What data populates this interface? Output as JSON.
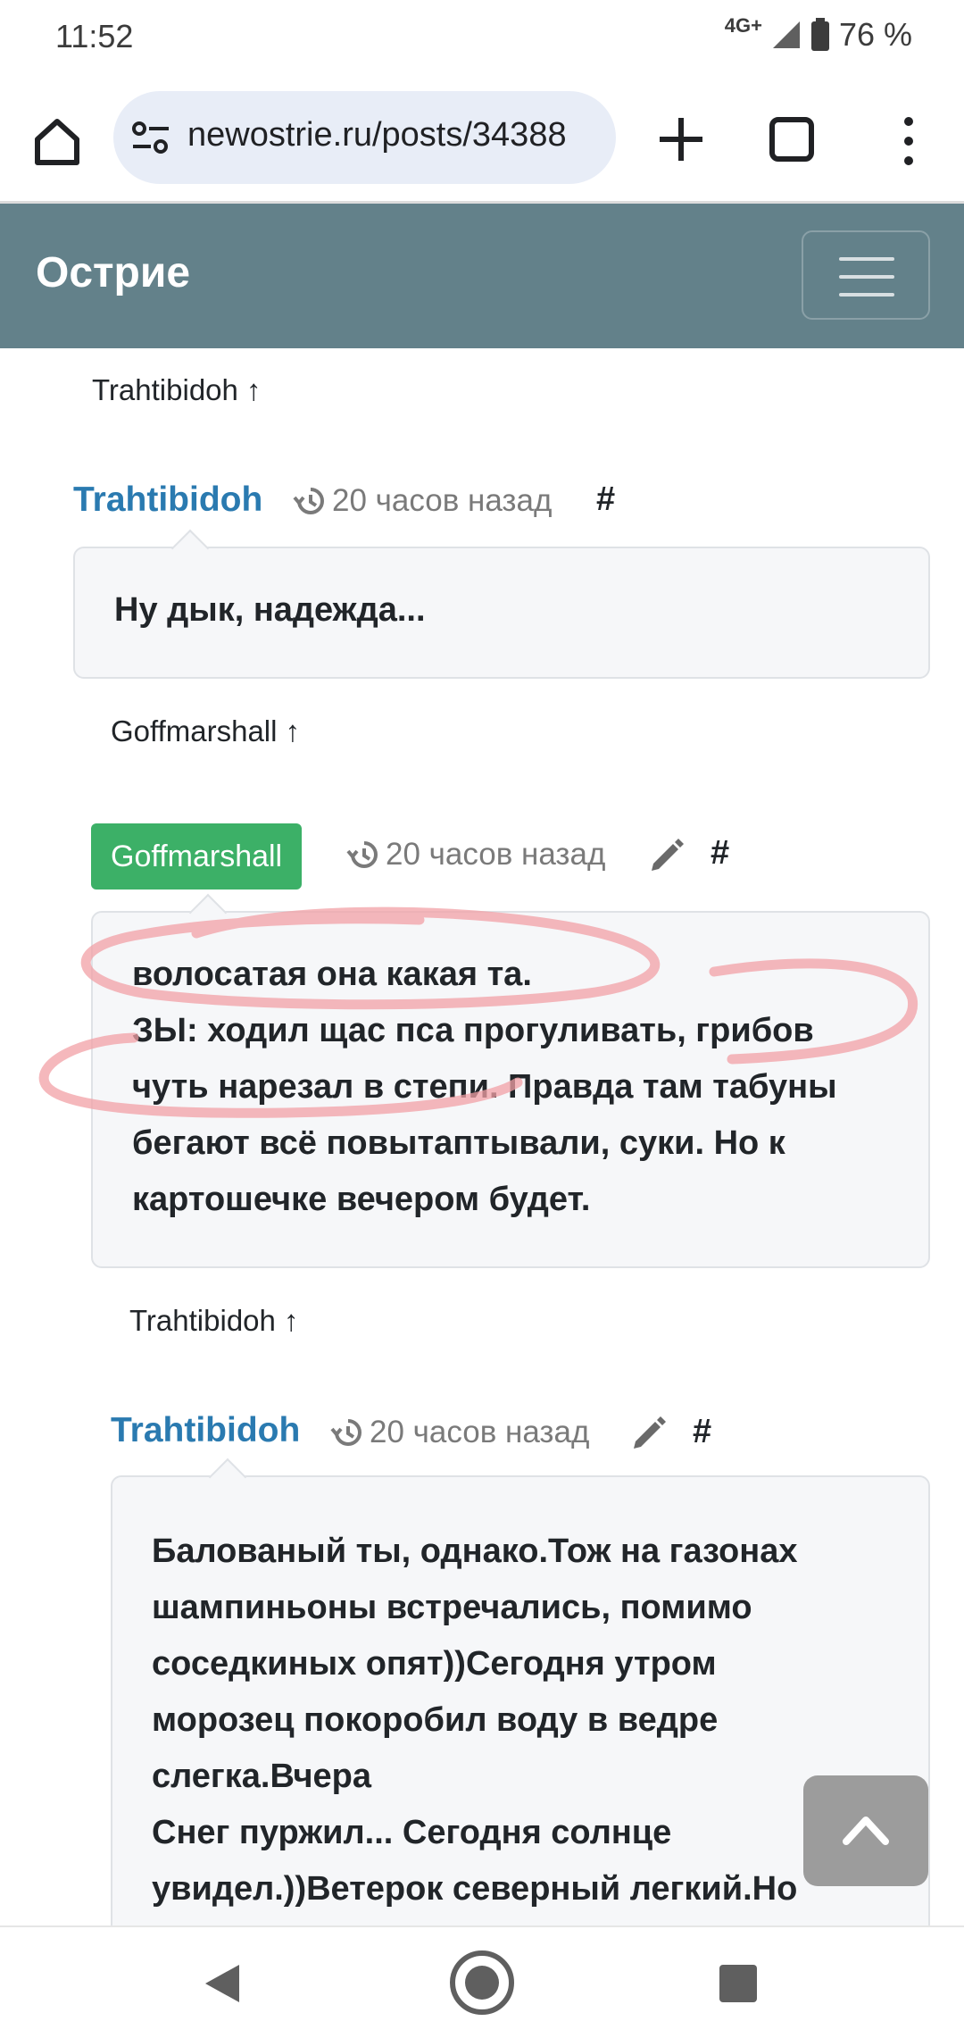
{
  "status_bar": {
    "time": "11:52",
    "network": "4G+",
    "battery": "76 %"
  },
  "browser": {
    "url": "newostrie.ru/posts/34388"
  },
  "navbar": {
    "brand": "Острие"
  },
  "comments": [
    {
      "reply_to": "Trahtibidoh ↑"
    },
    {
      "author": "Trahtibidoh",
      "time": "20 часов назад",
      "hash": "#",
      "text": "Ну дык, надежда..."
    },
    {
      "reply_to": "Goffmarshall ↑"
    },
    {
      "author": "Goffmarshall",
      "time": "20 часов назад",
      "hash": "#",
      "text": "волосатая она какая та.\nЗЫ: ходил щас пса прогуливать, грибов\nчуть нарезал в степи. Правда там табуны\nбегают всё повытаптывали, суки. Но к\nкартошечке вечером будет."
    },
    {
      "reply_to": "Trahtibidoh ↑"
    },
    {
      "author": "Trahtibidoh",
      "time": "20 часов назад",
      "hash": "#",
      "text": "Балованый ты, однако.Тож на газонах\nшампиньоны встречались, помимо\nсоседкиных опят))Сегодня утром\nморозец покоробил воду в ведре\nслегка.Вчера\nСнег пуржил... Сегодня солнце\nувидел.))Ветерок северный легкий.Но"
    }
  ],
  "icons": [
    "home-icon",
    "site-info-icon",
    "new-tab-icon",
    "tabs-icon",
    "more-icon",
    "history-icon",
    "pencil-icon",
    "chevron-up-icon",
    "back-icon",
    "home-circle-icon",
    "recents-icon"
  ],
  "colors": {
    "navbar": "#63818a",
    "author_link": "#2a7ab0",
    "highlight_badge": "#3cb067",
    "annotation": "#f2a0a6"
  }
}
